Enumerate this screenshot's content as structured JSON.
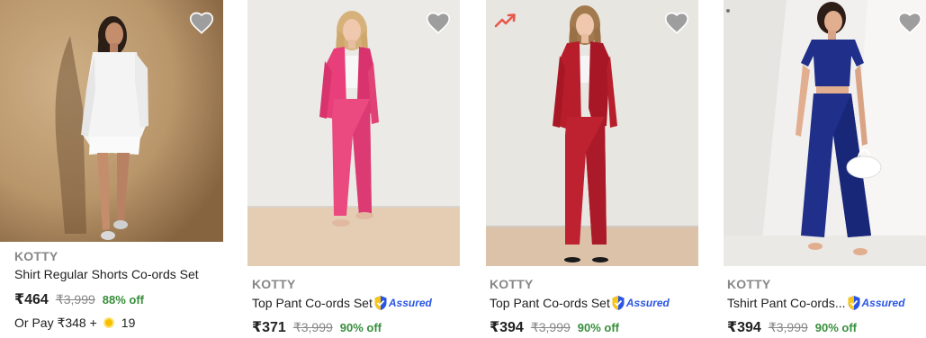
{
  "products": [
    {
      "brand": "KOTTY",
      "title": "Shirt Regular Shorts Co-ords Set",
      "assured": "",
      "price": "₹464",
      "mrp": "₹3,999",
      "discount": "88% off",
      "pay_prefix": "Or Pay ₹348 +",
      "pay_coins": "19",
      "badge": "none",
      "outfit_color": "#f4f4f4",
      "background_color": "#c9a476"
    },
    {
      "brand": "KOTTY",
      "title": "Top Pant Co-ords Set",
      "assured": "Assured",
      "price": "₹371",
      "mrp": "₹3,999",
      "discount": "90% off",
      "badge": "none",
      "outfit_color": "#e83f7a",
      "background_color": "#ebeae6"
    },
    {
      "brand": "KOTTY",
      "title": "Top Pant Co-ords Set",
      "assured": "Assured",
      "price": "₹394",
      "mrp": "₹3,999",
      "discount": "90% off",
      "badge": "trending-icon",
      "outfit_color": "#b71d2a",
      "background_color": "#e8e6e1"
    },
    {
      "brand": "KOTTY",
      "title": "Tshirt Pant Co-ords...",
      "assured": "Assured",
      "price": "₹394",
      "mrp": "₹3,999",
      "discount": "90% off",
      "badge": "dot",
      "outfit_color": "#1f2f8a",
      "background_color": "#f1f0ee"
    }
  ],
  "colors": {
    "discount_green": "#388e3c",
    "assured_blue": "#2a55e5",
    "muted_text": "#878787",
    "wishlist_heart": "#9e9e9e"
  }
}
